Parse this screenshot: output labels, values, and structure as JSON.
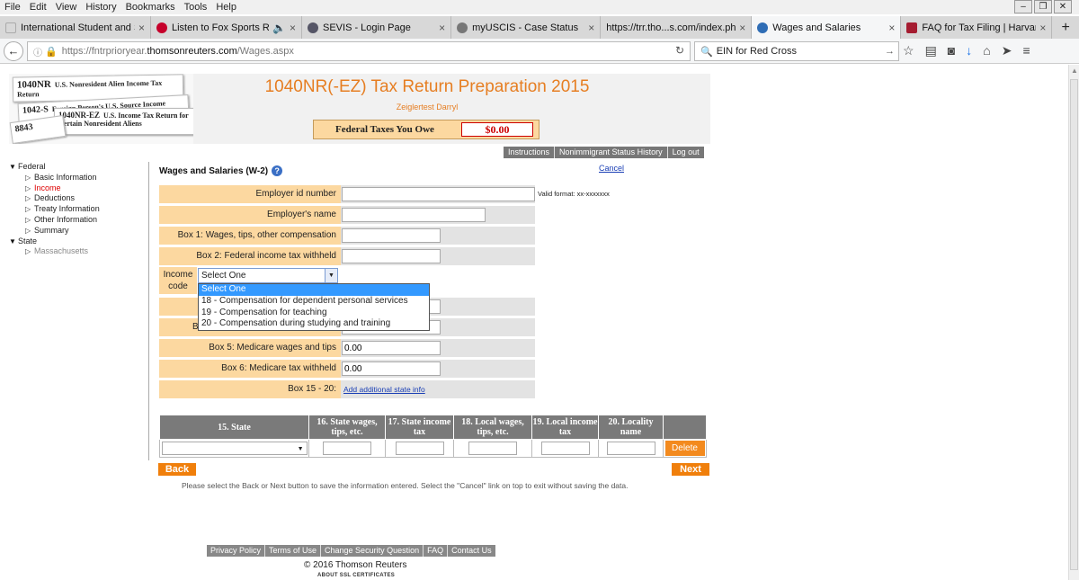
{
  "menubar": [
    "File",
    "Edit",
    "View",
    "History",
    "Bookmarks",
    "Tools",
    "Help"
  ],
  "tabs": [
    {
      "label": "International Student and Scho...",
      "icon": "university-icon",
      "color": "#ffffff"
    },
    {
      "label": "Listen to Fox Sports Ra...",
      "icon": "iheart-icon",
      "color": "#c6002b"
    },
    {
      "label": "SEVIS - Login Page",
      "icon": "seal-icon",
      "color": "#556"
    },
    {
      "label": "myUSCIS - Case Status",
      "icon": "uscis-icon",
      "color": "#777"
    },
    {
      "label": "https://trr.tho...s.com/index.php",
      "icon": "",
      "color": "#d8d8d8"
    },
    {
      "label": "Wages and Salaries",
      "icon": "page-icon",
      "color": "#2f6db5"
    },
    {
      "label": "FAQ for Tax Filing | Harvar...",
      "icon": "harvard-icon",
      "color": "#a51c30"
    }
  ],
  "url": {
    "prefix": "https://fntrprioryear.",
    "domain": "thomsonreuters.com",
    "path": "/Wages.aspx"
  },
  "search_query": "EIN for Red Cross",
  "header": {
    "title": "1040NR(-EZ) Tax Return Preparation 2015",
    "user": "Zeiglertest Darryl",
    "owe_label": "Federal Taxes You Owe",
    "owe_value": "$0.00",
    "forms": [
      "1040NR",
      "U.S. Nonresident Alien Income Tax Return",
      "1042-S",
      "Foreign Person's U.S. Source Income",
      "1040NR-EZ",
      "U.S. Income Tax Return for Certain Nonresident Aliens",
      "8843"
    ]
  },
  "toplinks": [
    "Instructions",
    "Nonimmigrant Status History",
    "Log out"
  ],
  "nav": {
    "federal": "Federal",
    "items": [
      "Basic Information",
      "Income",
      "Deductions",
      "Treaty Information",
      "Other Information",
      "Summary"
    ],
    "state": "State",
    "state_items": [
      "Massachusetts"
    ]
  },
  "section_title": "Wages and Salaries (W-2)",
  "cancel": "Cancel",
  "fields": [
    {
      "label": "Employer id number",
      "value": ""
    },
    {
      "label": "Employer's name",
      "value": ""
    },
    {
      "label": "Box 1: Wages, tips, other compensation",
      "value": ""
    },
    {
      "label": "Box 2: Federal income tax withheld",
      "value": ""
    }
  ],
  "valid_format": "Valid format: xx-xxxxxxx",
  "income_code": {
    "label_line1": "Income",
    "label_line2": "code",
    "selected": "Select One",
    "options": [
      "Select One",
      "18 - Compensation for dependent personal services",
      "19 - Compensation for teaching",
      "20 - Compensation during studying and training"
    ]
  },
  "hidden_row_fragment": "B",
  "lower_fields": [
    {
      "label": "Box 5: Medicare wages and tips",
      "value": "0.00"
    },
    {
      "label": "Box 6: Medicare tax withheld",
      "value": "0.00"
    }
  ],
  "box15": {
    "label": "Box 15 - 20:",
    "link": "Add additional state info"
  },
  "table": {
    "headers": [
      "15. State",
      "16. State wages, tips, etc.",
      "17. State income tax",
      "18. Local wages, tips, etc.",
      "19. Local income tax",
      "20. Locality name"
    ],
    "delete_label": "Delete"
  },
  "buttons": {
    "back": "Back",
    "next": "Next"
  },
  "note": "Please select the Back or Next button to save the information entered. Select the \"Cancel\" link on top to exit without saving the data.",
  "footer": {
    "links": [
      "Privacy Policy",
      "Terms of Use",
      "Change Security Question",
      "FAQ",
      "Contact Us"
    ],
    "copyright": "© 2016 Thomson Reuters",
    "ssl": "ABOUT SSL CERTIFICATES"
  },
  "colors": {
    "orange": "#e67e22",
    "peach": "#fcd8a0",
    "button": "#f07f0b"
  }
}
